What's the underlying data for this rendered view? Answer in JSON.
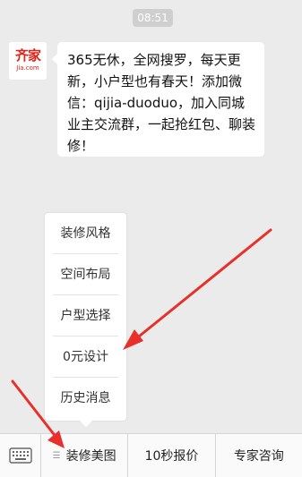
{
  "status": {
    "time": "08:51"
  },
  "avatar": {
    "logo_top": "齐家",
    "logo_bottom": "Jia.com"
  },
  "message": {
    "text": "365无休，全网搜罗，每天更新，小户型也有春天！添加微信：qijia-duoduo，加入同城业主交流群，一起抢红包、聊装修！"
  },
  "submenu": {
    "items": [
      {
        "label": "装修风格"
      },
      {
        "label": "空间布局"
      },
      {
        "label": "户型选择"
      },
      {
        "label": "0元设计"
      },
      {
        "label": "历史消息"
      }
    ]
  },
  "bottom_menu": {
    "keyboard_icon": "keyboard-icon",
    "tabs": [
      {
        "label": "装修美图"
      },
      {
        "label": "10秒报价"
      },
      {
        "label": "专家咨询"
      }
    ]
  },
  "colors": {
    "arrow": "#e8302a",
    "brand": "#e2231a",
    "background": "#ebebeb"
  }
}
